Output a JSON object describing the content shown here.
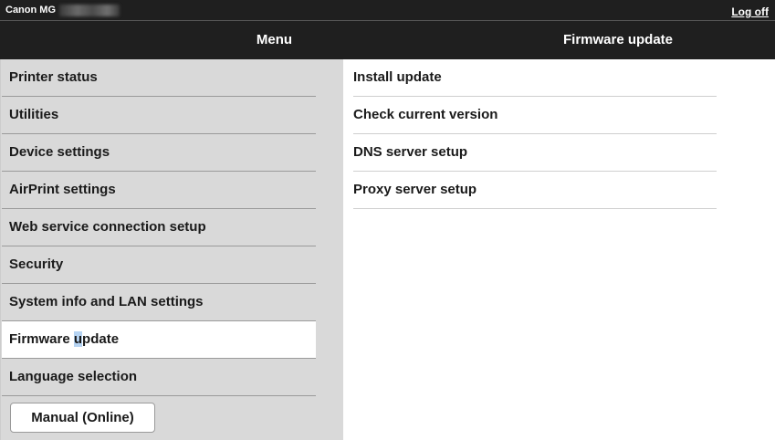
{
  "topbar": {
    "model_label": "Canon MG",
    "logoff_label": "Log off"
  },
  "header": {
    "menu_title": "Menu",
    "content_title": "Firmware update"
  },
  "sidebar": {
    "items": [
      {
        "label": "Printer status"
      },
      {
        "label": "Utilities"
      },
      {
        "label": "Device settings"
      },
      {
        "label": "AirPrint settings"
      },
      {
        "label": "Web service connection setup"
      },
      {
        "label": "Security"
      },
      {
        "label": "System info and LAN settings"
      },
      {
        "label_before": "Firmware ",
        "label_highlight": "u",
        "label_after": "pdate",
        "active": true
      },
      {
        "label": "Language selection"
      }
    ],
    "manual_button": "Manual (Online)"
  },
  "content": {
    "items": [
      {
        "label": "Install update"
      },
      {
        "label": "Check current version"
      },
      {
        "label": "DNS server setup"
      },
      {
        "label": "Proxy server setup"
      }
    ]
  },
  "colors": {
    "bar_background": "#1f1f1f",
    "sidebar_background": "#d9d9d9",
    "active_item_background": "#ffffff",
    "text_selection": "#b5d3f2"
  }
}
